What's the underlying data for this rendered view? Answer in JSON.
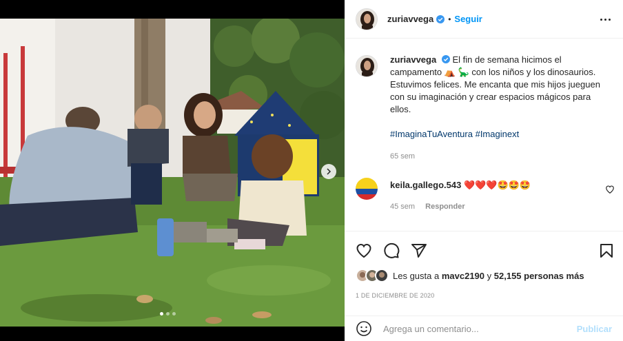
{
  "post": {
    "username": "zuriavvega",
    "follow_label": "Seguir",
    "separator": "•"
  },
  "caption": {
    "username": "zuriavvega",
    "text_part1": "El fin de semana hicimos el campamento ",
    "emoji1": "⛺",
    "emoji2": "🦕",
    "text_part2": " con los niños y los dinosaurios. Estuvimos felices. Me encanta que mis hijos jueguen con su imaginación y crear espacios mágicos para ellos.",
    "hashtag1": "#ImaginaTuAventura",
    "hashtag2": "#Imaginext",
    "time": "65 sem"
  },
  "comment": {
    "username": "keila.gallego.543",
    "emojis": "❤️❤️❤️🤩🤩🤩",
    "time": "45 sem",
    "reply_label": "Responder"
  },
  "likes": {
    "prefix": "Les gusta a ",
    "user": "mavc2190",
    "middle": " y ",
    "count": "52,155 personas más"
  },
  "date": "1 de diciembre de 2020",
  "composer": {
    "placeholder": "Agrega un comentario...",
    "publish_label": "Publicar"
  },
  "carousel": {
    "total_images": 3,
    "active_index": 0
  },
  "icons": {
    "verified": "verified-badge-icon",
    "more": "more-options-icon",
    "like": "heart-icon",
    "comment": "comment-icon",
    "share": "share-icon",
    "save": "bookmark-icon",
    "emoji": "emoji-icon",
    "next": "chevron-right-icon"
  },
  "colors": {
    "accent": "#0095f6",
    "hashtag": "#00376b",
    "muted": "#8e8e8e"
  }
}
